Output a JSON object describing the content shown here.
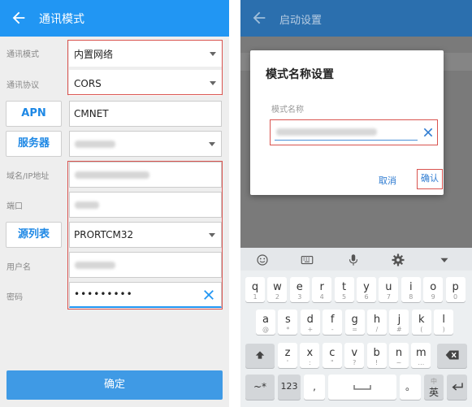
{
  "left": {
    "title": "通讯模式",
    "rows": {
      "mode_label": "通讯模式",
      "mode_value": "内置网络",
      "protocol_label": "通讯协议",
      "protocol_value": "CORS",
      "apn_button": "APN",
      "apn_value": "CMNET",
      "server_button": "服务器",
      "domain_label": "域名/IP地址",
      "port_label": "端口",
      "source_button": "源列表",
      "source_value": "PRORTCM32",
      "user_label": "用户名",
      "password_label": "密码",
      "password_value": "•••••••••"
    },
    "confirm": "确定"
  },
  "right": {
    "title": "启动设置",
    "dialog": {
      "title": "模式名称设置",
      "field_label": "模式名称",
      "cancel": "取消",
      "ok": "确认"
    },
    "keyboard": {
      "row1": [
        {
          "k": "q",
          "s": "1"
        },
        {
          "k": "w",
          "s": "2"
        },
        {
          "k": "e",
          "s": "3"
        },
        {
          "k": "r",
          "s": "4"
        },
        {
          "k": "t",
          "s": "5"
        },
        {
          "k": "y",
          "s": "6"
        },
        {
          "k": "u",
          "s": "7"
        },
        {
          "k": "i",
          "s": "8"
        },
        {
          "k": "o",
          "s": "9"
        },
        {
          "k": "p",
          "s": "0"
        }
      ],
      "row2": [
        {
          "k": "a",
          "s": "@"
        },
        {
          "k": "s",
          "s": "*"
        },
        {
          "k": "d",
          "s": "+"
        },
        {
          "k": "f",
          "s": "-"
        },
        {
          "k": "g",
          "s": "="
        },
        {
          "k": "h",
          "s": "/"
        },
        {
          "k": "j",
          "s": "#"
        },
        {
          "k": "k",
          "s": "("
        },
        {
          "k": "l",
          "s": ")"
        }
      ],
      "row3": [
        {
          "k": "z",
          "s": "'"
        },
        {
          "k": "x",
          "s": ":"
        },
        {
          "k": "c",
          "s": "\""
        },
        {
          "k": "v",
          "s": "?"
        },
        {
          "k": "b",
          "s": "!"
        },
        {
          "k": "n",
          "s": "~"
        },
        {
          "k": "m",
          "s": "…"
        }
      ],
      "sym_key": "~*",
      "num_key": "123",
      "comma_key": ",",
      "dot_key": "。",
      "lang_key": "英",
      "lang_sub": "中"
    }
  }
}
